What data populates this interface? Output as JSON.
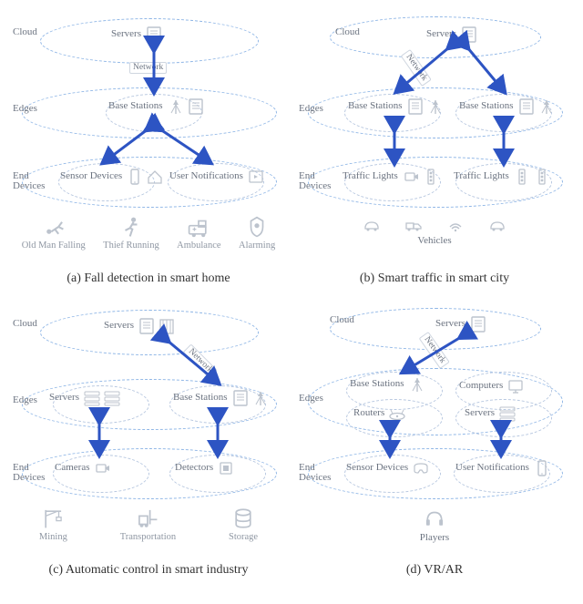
{
  "layers": {
    "cloud": "Cloud",
    "edges": "Edges",
    "end": "End\nDevices"
  },
  "shared": {
    "servers": "Servers",
    "base_stations": "Base\nStations",
    "network": "Network",
    "routers": "Routers",
    "computers": "Computers"
  },
  "panels": {
    "a": {
      "caption": "(a) Fall detection in smart home",
      "nodes": {
        "sensor_devices": "Sensor\nDevices",
        "user_notifications": "User\nNotifications"
      },
      "ground": {
        "old_man_falling": "Old Man Falling",
        "thief_running": "Thief Running",
        "ambulance": "Ambulance",
        "alarming": "Alarming"
      }
    },
    "b": {
      "caption": "(b) Smart traffic in smart city",
      "nodes": {
        "traffic_lights": "Traffic\nLights"
      },
      "ground_label": "Vehicles"
    },
    "c": {
      "caption": "(c) Automatic control in smart industry",
      "nodes": {
        "servers_edge": "Servers",
        "cameras": "Cameras",
        "detectors": "Detectors"
      },
      "ground": {
        "mining": "Mining",
        "transportation": "Transportation",
        "storage": "Storage"
      }
    },
    "d": {
      "caption": "(d) VR/AR",
      "nodes": {
        "sensor_devices": "Sensor\nDevices",
        "user_notifications": "User\nNotifications"
      },
      "ground_label": "Players"
    }
  }
}
